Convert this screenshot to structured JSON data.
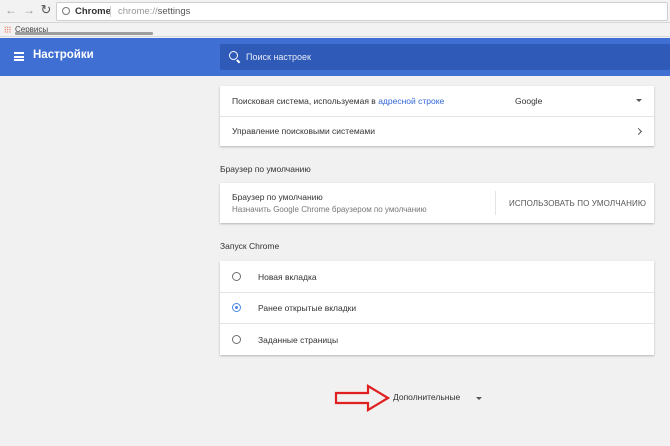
{
  "browser": {
    "tab_origin": "Chrome",
    "url_scheme": "chrome://",
    "url_path": "settings",
    "bookmarks_bar_label": "Сервисы"
  },
  "header": {
    "title": "Настройки",
    "search_placeholder": "Поиск настроек"
  },
  "search_engine": {
    "row1_prefix": "Поисковая система, используемая в ",
    "row1_link": "адресной строке",
    "selected_engine": "Google",
    "row2_label": "Управление поисковыми системами"
  },
  "default_browser": {
    "section_title": "Браузер по умолчанию",
    "label": "Браузер по умолчанию",
    "sublabel": "Назначить Google Chrome браузером по умолчанию",
    "button": "ИСПОЛЬЗОВАТЬ ПО УМОЛЧАНИЮ"
  },
  "startup": {
    "section_title": "Запуск Chrome",
    "options": [
      {
        "label": "Новая вкладка",
        "checked": false
      },
      {
        "label": "Ранее открытые вкладки",
        "checked": true
      },
      {
        "label": "Заданные страницы",
        "checked": false
      }
    ]
  },
  "advanced": {
    "label": "Дополнительные"
  },
  "colors": {
    "header_blue": "#3f6fd3",
    "search_bg": "#2f5ab8",
    "link": "#3367d6",
    "radio_checked": "#4a86e8",
    "annotation_arrow": "#e02020"
  },
  "icons": [
    "back-arrow-icon",
    "forward-arrow-icon",
    "reload-icon",
    "page-info-icon",
    "apps-icon",
    "hamburger-menu-icon",
    "search-icon",
    "dropdown-caret-icon",
    "chevron-right-icon",
    "red-arrow-annotation"
  ]
}
